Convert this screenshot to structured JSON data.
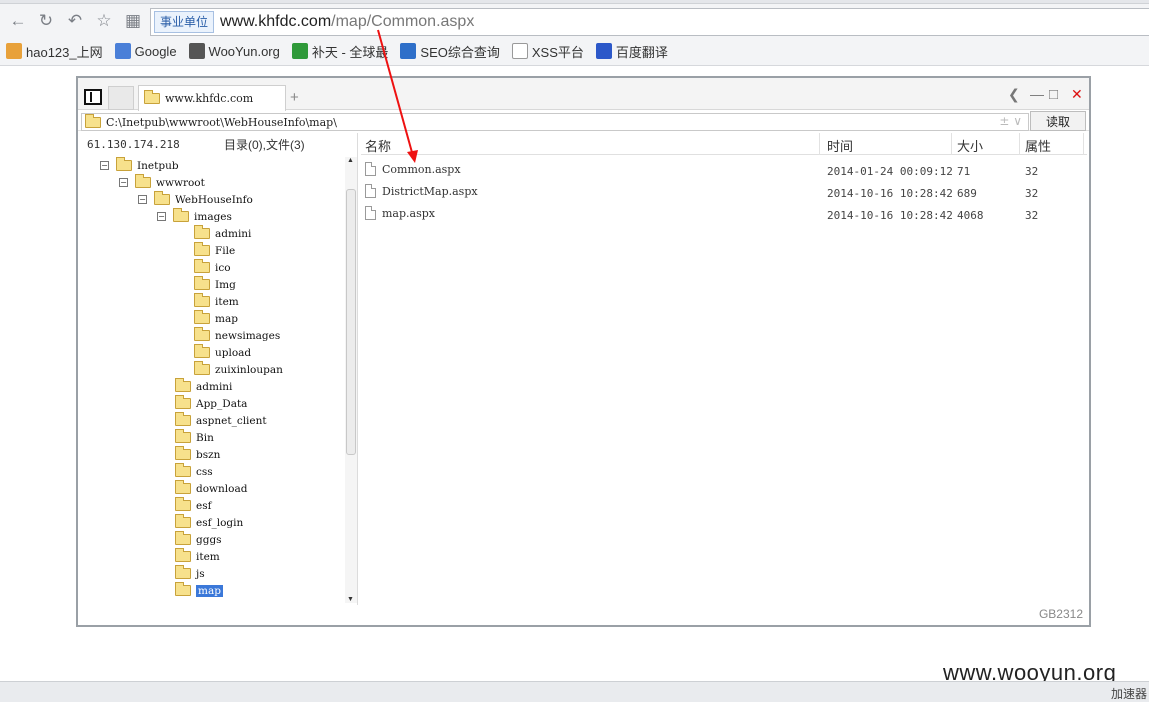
{
  "browser": {
    "address_badge": "事业单位",
    "url_host": "www.khfdc.com",
    "url_path": "/map/Common.aspx",
    "bookmarks": [
      {
        "label": "hao123_上网",
        "icon": "hao123-icon",
        "color": "#e8a13a"
      },
      {
        "label": "Google",
        "icon": "google-icon",
        "color": "#4a7fd8"
      },
      {
        "label": "WooYun.org",
        "icon": "wooyun-icon",
        "color": "#555555"
      },
      {
        "label": "补天 - 全球最",
        "icon": "butian-icon",
        "color": "#2f9a3a"
      },
      {
        "label": "SEO综合查询",
        "icon": "seo-icon",
        "color": "#2e6fc9"
      },
      {
        "label": "XSS平台",
        "icon": "page-icon",
        "color": "#ffffff"
      },
      {
        "label": "百度翻译",
        "icon": "baidu-icon",
        "color": "#2c58c9"
      }
    ]
  },
  "panel": {
    "tab_title": "www.khfdc.com",
    "path": "C:\\Inetpub\\wwwroot\\WebHouseInfo\\map\\",
    "path_tail": "± ∨",
    "read_button": "读取",
    "ip": "61.130.174.218",
    "counts": "目录(0),文件(3)",
    "columns": {
      "name": "名称",
      "time": "时间",
      "size": "大小",
      "attr": "属性"
    },
    "files": [
      {
        "name": "Common.aspx",
        "time": "2014-01-24 00:09:12",
        "size": "71",
        "attr": "32"
      },
      {
        "name": "DistrictMap.aspx",
        "time": "2014-10-16 10:28:42",
        "size": "689",
        "attr": "32"
      },
      {
        "name": "map.aspx",
        "time": "2014-10-16 10:28:42",
        "size": "4068",
        "attr": "32"
      }
    ],
    "tree": [
      {
        "label": "Inetpub",
        "level": 0,
        "toggle": "−"
      },
      {
        "label": "wwwroot",
        "level": 1,
        "toggle": "−"
      },
      {
        "label": "WebHouseInfo",
        "level": 2,
        "toggle": "−"
      },
      {
        "label": "images",
        "level": 3,
        "toggle": "−"
      },
      {
        "label": "admini",
        "level": 4,
        "toggle": ""
      },
      {
        "label": "File",
        "level": 4,
        "toggle": ""
      },
      {
        "label": "ico",
        "level": 4,
        "toggle": ""
      },
      {
        "label": "Img",
        "level": 4,
        "toggle": ""
      },
      {
        "label": "item",
        "level": 4,
        "toggle": ""
      },
      {
        "label": "map",
        "level": 4,
        "toggle": ""
      },
      {
        "label": "newsimages",
        "level": 4,
        "toggle": ""
      },
      {
        "label": "upload",
        "level": 4,
        "toggle": ""
      },
      {
        "label": "zuixinloupan",
        "level": 4,
        "toggle": ""
      },
      {
        "label": "admini",
        "level": 3,
        "toggle": ""
      },
      {
        "label": "App_Data",
        "level": 3,
        "toggle": ""
      },
      {
        "label": "aspnet_client",
        "level": 3,
        "toggle": ""
      },
      {
        "label": "Bin",
        "level": 3,
        "toggle": ""
      },
      {
        "label": "bszn",
        "level": 3,
        "toggle": ""
      },
      {
        "label": "css",
        "level": 3,
        "toggle": ""
      },
      {
        "label": "download",
        "level": 3,
        "toggle": ""
      },
      {
        "label": "esf",
        "level": 3,
        "toggle": ""
      },
      {
        "label": "esf_login",
        "level": 3,
        "toggle": ""
      },
      {
        "label": "gggs",
        "level": 3,
        "toggle": ""
      },
      {
        "label": "item",
        "level": 3,
        "toggle": ""
      },
      {
        "label": "js",
        "level": 3,
        "toggle": ""
      },
      {
        "label": "map",
        "level": 3,
        "toggle": "",
        "selected": true
      }
    ],
    "encoding": "GB2312"
  },
  "watermark": "www.wooyun.org",
  "status_accelerator": "加速器",
  "annotation_color": "#ee1111"
}
